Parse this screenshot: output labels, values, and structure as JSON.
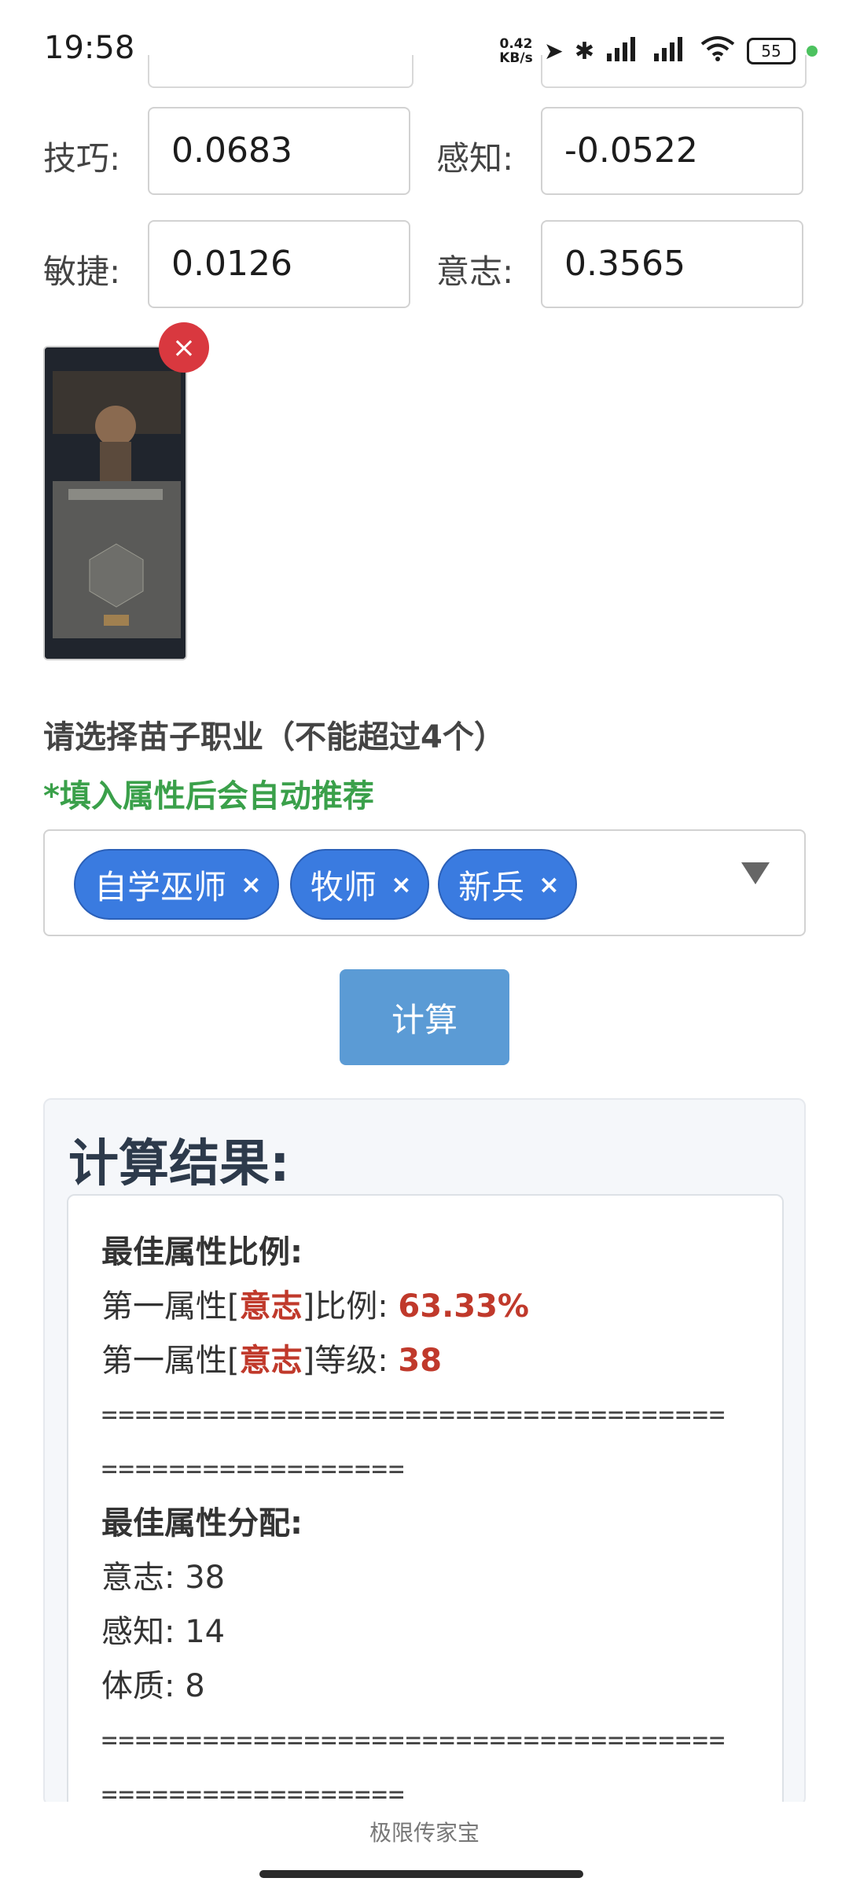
{
  "status": {
    "time": "19:58",
    "net_speed_value": "0.42",
    "net_speed_unit": "KB/s",
    "battery": "55"
  },
  "attributes": [
    {
      "label": "技巧:",
      "value": "0.0683"
    },
    {
      "label": "感知:",
      "value": "-0.0522"
    },
    {
      "label": "敏捷:",
      "value": "0.0126"
    },
    {
      "label": "意志:",
      "value": "0.3565"
    }
  ],
  "upload": {
    "remove_icon": "×"
  },
  "selection": {
    "title": "请选择苗子职业（不能超过4个）",
    "hint": "*填入属性后会自动推荐",
    "chips": [
      "自学巫师",
      "牧师",
      "新兵"
    ],
    "remove_icon": "×"
  },
  "calculate_button": "计算",
  "results": {
    "title": "计算结果:",
    "best_ratio_heading": "最佳属性比例:",
    "line1_prefix": "第一属性[",
    "line1_attr": "意志",
    "line1_mid": "]比例: ",
    "line1_value": "63.33%",
    "line2_prefix": "第一属性[",
    "line2_attr": "意志",
    "line2_mid": "]等级: ",
    "line2_value": "38",
    "separator_a": "=====================================",
    "separator_b": "==================",
    "best_alloc_heading": "最佳属性分配:",
    "alloc": [
      "意志: 38",
      "感知: 14",
      "体质: 8"
    ],
    "separator_c": "=====================================",
    "separator_d": "=================="
  },
  "footer": {
    "app_name": "极限传家宝"
  }
}
